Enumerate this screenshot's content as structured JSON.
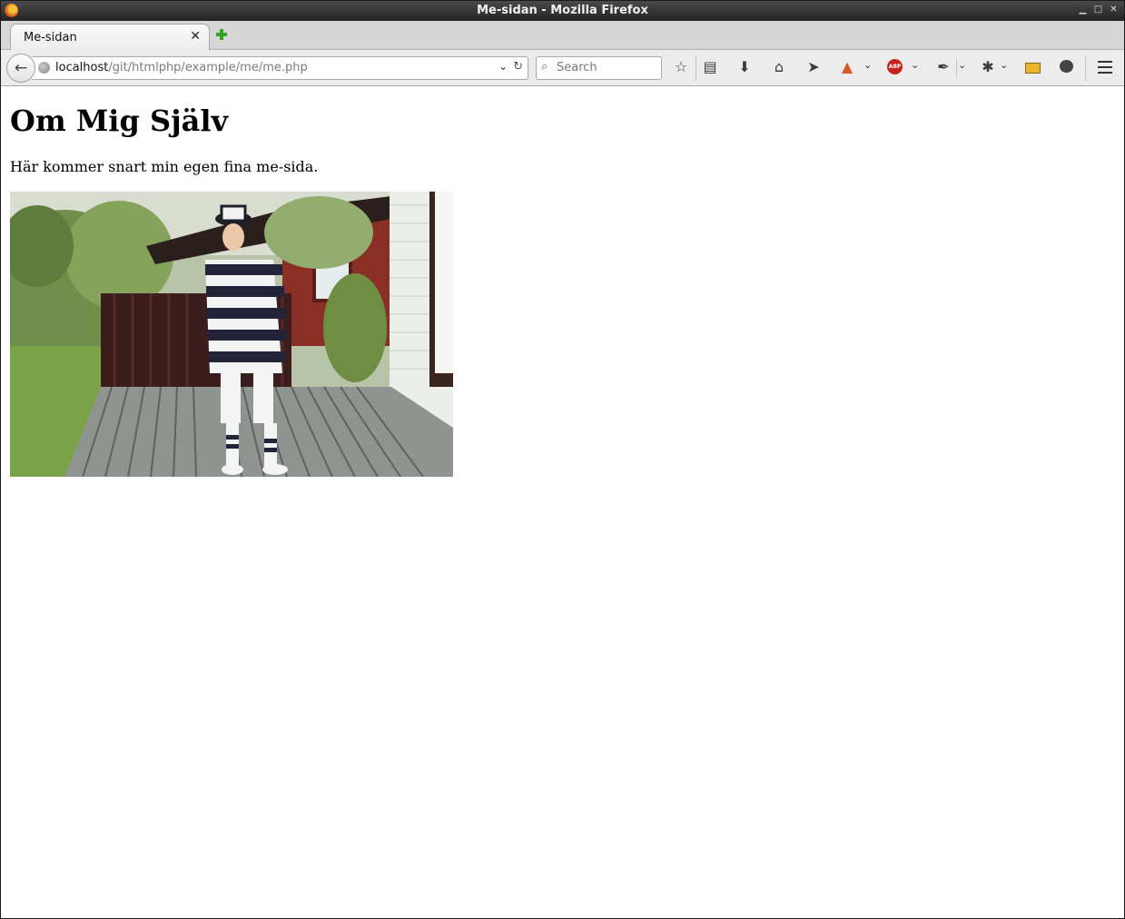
{
  "window": {
    "title": "Me-sidan - Mozilla Firefox",
    "controls": [
      "minimize",
      "maximize",
      "close"
    ]
  },
  "tabs": [
    {
      "label": "Me-sidan",
      "active": true
    }
  ],
  "navbar": {
    "url_host": "localhost",
    "url_path": "/git/htmlphp/example/me/me.php",
    "search_placeholder": "Search",
    "toolbar_icons": [
      "star-icon",
      "reading-list-icon",
      "download-icon",
      "home-icon",
      "send-icon",
      "color-picker-icon",
      "adblock-plus-icon",
      "eyedropper-icon",
      "bug-icon",
      "ruler-icon",
      "chat-icon",
      "menu-icon"
    ]
  },
  "page": {
    "heading": "Om Mig Själv",
    "paragraph": "Här kommer snart min egen fina me-sida.",
    "image_description_icon": "photo"
  },
  "colors": {
    "titlebar": "#2b2b2b",
    "tab_bg": "#f2f2f2",
    "navbar_bg": "#ececec",
    "abp_red": "#c8211b",
    "newtab_green": "#3aa02a"
  }
}
